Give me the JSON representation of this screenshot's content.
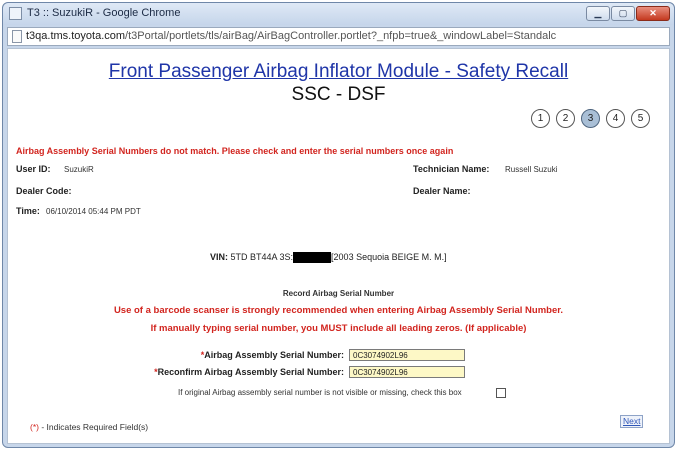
{
  "browser": {
    "window_title": "T3 :: SuzukiR - Google Chrome",
    "window_controls": {
      "minimize": "▁",
      "maximize": "▢",
      "close": "✕"
    },
    "url_host": "t3qa.tms.toyota.com",
    "url_path": "/t3Portal/portlets/tls/airBag/AirBagController.portlet?_nfpb=true&_windowLabel=Standalc"
  },
  "page": {
    "title": "Front Passenger Airbag Inflator Module - Safety Recall",
    "subtitle": "SSC - DSF",
    "steps": [
      {
        "label": "1",
        "active": false
      },
      {
        "label": "2",
        "active": false
      },
      {
        "label": "3",
        "active": true
      },
      {
        "label": "4",
        "active": false
      },
      {
        "label": "5",
        "active": false
      }
    ],
    "error_message": "Airbag Assembly Serial Numbers do not match. Please check and enter the serial numbers once again",
    "info": {
      "user_id_label": "User ID:",
      "user_id_value": "SuzukiR",
      "technician_label": "Technician Name:",
      "technician_value": "Russell Suzuki",
      "dealer_code_label": "Dealer Code:",
      "dealer_code_value": "",
      "dealer_name_label": "Dealer Name:",
      "dealer_name_value": "",
      "time_label": "Time:",
      "time_value": "06/10/2014 05:44 PM PDT"
    },
    "vin": {
      "label": "VIN:",
      "prefix": "5TD BT44A 3S:",
      "suffix": "[2003 Sequoia BEIGE M. M.]"
    },
    "record_heading": "Record Airbag Serial Number",
    "warning_line_1": "Use of a barcode scanser is strongly recommended when entering Airbag Assembly Serial Number.",
    "warning_line_2": "If manually typing serial number, you MUST include all leading zeros. (If applicable)",
    "fields": {
      "required_mark": "*",
      "serial_label": "Airbag Assembly Serial Number:",
      "serial_value": "0C3074902L96",
      "reconfirm_label": "Reconfirm Airbag Assembly Serial Number:",
      "reconfirm_value": "0C3074902L96"
    },
    "checkbox_note": "If original Airbag assembly serial number is not visible or missing, check this box",
    "checkbox_checked": false,
    "footnote_mark": "(*)",
    "footnote_text": " - Indicates Required Field(s)",
    "next_label": "Next"
  },
  "colors": {
    "title_link": "#1f35a8",
    "error_red": "#d2251f",
    "input_yellow": "#fdf8c6",
    "active_step": "#a9bfd6"
  }
}
